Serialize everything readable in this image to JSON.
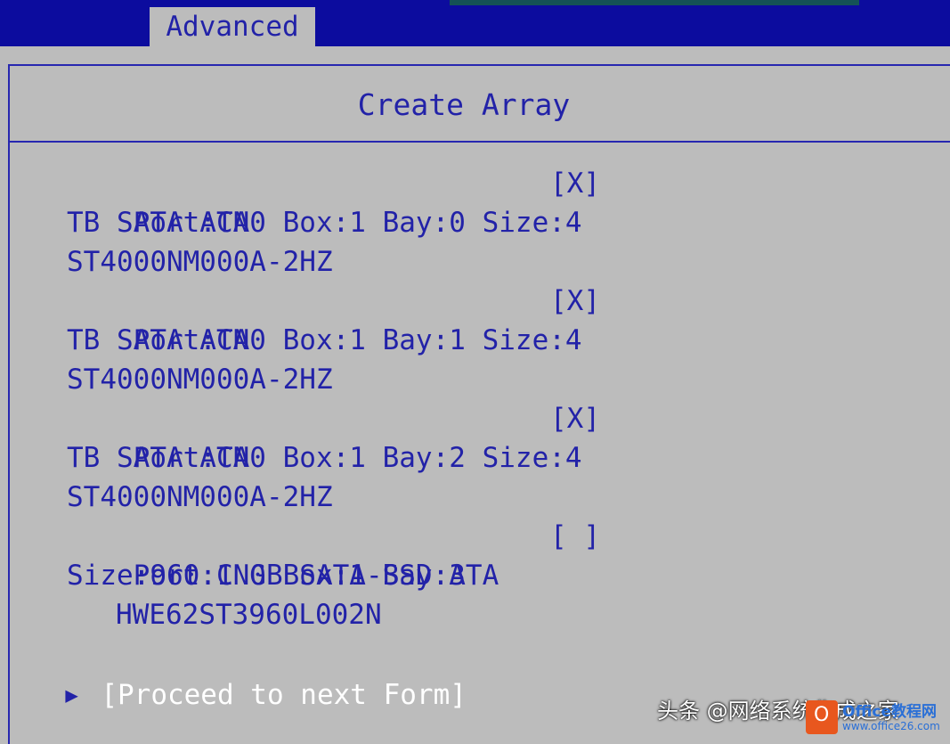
{
  "header": {
    "active_tab": "Advanced"
  },
  "panel": {
    "title": "Create Array"
  },
  "drives": [
    {
      "port_line": "Port:CN0 Box:1 Bay:0 Size:4",
      "check": "[X]",
      "line2": "TB SATA ATA",
      "line3": "ST4000NM000A-2HZ"
    },
    {
      "port_line": "Port:CN0 Box:1 Bay:1 Size:4",
      "check": "[X]",
      "line2": "TB SATA ATA",
      "line3": "ST4000NM000A-2HZ"
    },
    {
      "port_line": "Port:CN0 Box:1 Bay:2 Size:4",
      "check": "[X]",
      "line2": "TB SATA ATA",
      "line3": "ST4000NM000A-2HZ"
    },
    {
      "port_line": "Port:CN0 Box:1 Bay:3",
      "check": "[ ]",
      "line2": "Size:960.1 GB SATA-SSD ATA",
      "line3": "HWE62ST3960L002N"
    }
  ],
  "proceed": {
    "arrow": "▶",
    "label": "[Proceed to next Form]"
  },
  "watermark": {
    "text": "头条 @网络系统集成之家",
    "logo": "O",
    "site": "Office教程网",
    "url": "www.office26.com"
  }
}
